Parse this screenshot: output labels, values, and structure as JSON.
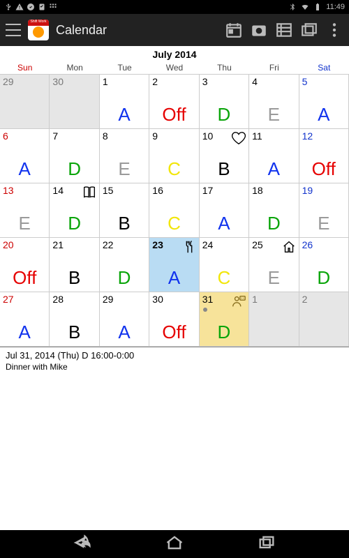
{
  "status": {
    "time": "11:49"
  },
  "appbar": {
    "title": "Calendar"
  },
  "month_title": "July 2014",
  "dow": [
    "Sun",
    "Mon",
    "Tue",
    "Wed",
    "Thu",
    "Fri",
    "Sat"
  ],
  "dow_colors": [
    "#cc0000",
    "#444",
    "#444",
    "#444",
    "#444",
    "#444",
    "#1133cc"
  ],
  "colors": {
    "A": "#1133ee",
    "B": "#000000",
    "C": "#f2e60a",
    "D": "#0aa50a",
    "E": "#9a9a9a",
    "Off": "#e60000"
  },
  "numcolors": {
    "sun": "#cc0000",
    "sat": "#1133cc",
    "default": "#000",
    "out": "#777"
  },
  "cells": [
    {
      "n": "29",
      "out": true
    },
    {
      "n": "30",
      "out": true
    },
    {
      "n": "1",
      "s": "A"
    },
    {
      "n": "2",
      "s": "Off"
    },
    {
      "n": "3",
      "s": "D"
    },
    {
      "n": "4",
      "s": "E"
    },
    {
      "n": "5",
      "s": "A",
      "sat": true
    },
    {
      "n": "6",
      "s": "A",
      "sun": true
    },
    {
      "n": "7",
      "s": "D"
    },
    {
      "n": "8",
      "s": "E"
    },
    {
      "n": "9",
      "s": "C"
    },
    {
      "n": "10",
      "s": "B",
      "icon": "heart"
    },
    {
      "n": "11",
      "s": "A"
    },
    {
      "n": "12",
      "s": "Off",
      "sat": true
    },
    {
      "n": "13",
      "s": "E",
      "sun": true
    },
    {
      "n": "14",
      "s": "D",
      "icon": "book"
    },
    {
      "n": "15",
      "s": "B"
    },
    {
      "n": "16",
      "s": "C"
    },
    {
      "n": "17",
      "s": "A"
    },
    {
      "n": "18",
      "s": "D"
    },
    {
      "n": "19",
      "s": "E",
      "sat": true
    },
    {
      "n": "20",
      "s": "Off",
      "sun": true
    },
    {
      "n": "21",
      "s": "B"
    },
    {
      "n": "22",
      "s": "D"
    },
    {
      "n": "23",
      "s": "A",
      "cur": true,
      "icon": "fork",
      "bold": true
    },
    {
      "n": "24",
      "s": "C"
    },
    {
      "n": "25",
      "s": "E",
      "icon": "home"
    },
    {
      "n": "26",
      "s": "D",
      "sat": true
    },
    {
      "n": "27",
      "s": "A",
      "sun": true
    },
    {
      "n": "28",
      "s": "B"
    },
    {
      "n": "29",
      "s": "A"
    },
    {
      "n": "30",
      "s": "Off"
    },
    {
      "n": "31",
      "s": "D",
      "sel": true,
      "icon": "person",
      "dot": true
    },
    {
      "n": "1",
      "out": true
    },
    {
      "n": "2",
      "out": true
    },
    {
      "hidden": true
    },
    {
      "hidden": true
    },
    {
      "hidden": true
    },
    {
      "hidden": true
    },
    {
      "hidden": true
    },
    {
      "hidden": true
    },
    {
      "hidden": true
    }
  ],
  "detail": {
    "line1": "Jul 31, 2014 (Thu) D 16:00-0:00",
    "line2": "Dinner with Mike"
  }
}
